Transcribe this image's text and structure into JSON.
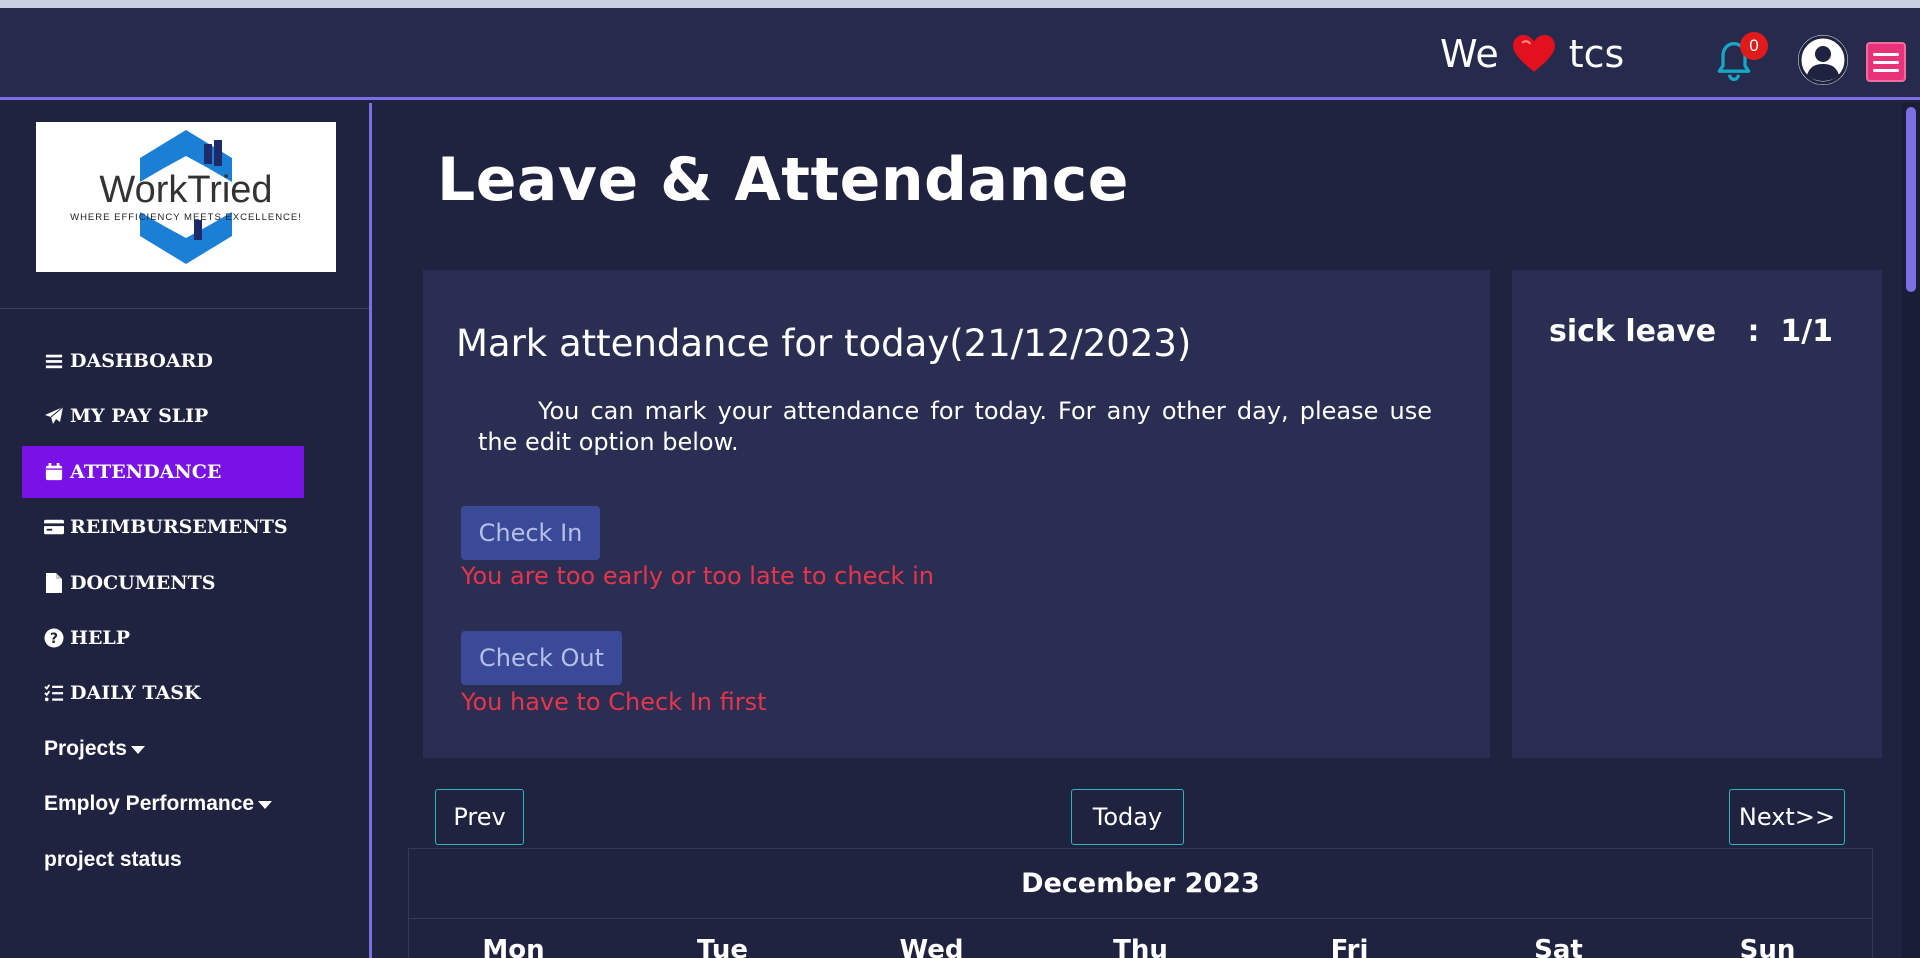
{
  "header": {
    "brand_we": "We",
    "brand_company": "tcs",
    "notification_count": "0",
    "accent_color": "#7c6fe3",
    "menu_color": "#e8327a"
  },
  "sidebar": {
    "logo": {
      "name": "WorkTried",
      "tagline": "WHERE EFFICIENCY MEETS EXCELLENCE!"
    },
    "items": [
      {
        "label": "DASHBOARD",
        "icon": "bars-icon"
      },
      {
        "label": "MY PAY SLIP",
        "icon": "paper-plane-icon"
      },
      {
        "label": "ATTENDANCE",
        "icon": "calendar-icon",
        "active": true
      },
      {
        "label": "REIMBURSEMENTS",
        "icon": "credit-card-icon"
      },
      {
        "label": "DOCUMENTS",
        "icon": "file-icon"
      },
      {
        "label": "HELP",
        "icon": "question-circle-icon"
      },
      {
        "label": "DAILY TASK",
        "icon": "task-list-icon"
      },
      {
        "label": "Projects",
        "icon": "caret-down-icon"
      },
      {
        "label": "Employ Performance",
        "icon": "caret-down-icon"
      },
      {
        "label": "project status"
      }
    ],
    "active_color": "#7a12e8"
  },
  "main": {
    "page_title": "Leave & Attendance",
    "attendance": {
      "title": "Mark attendance for today(21/12/2023)",
      "description": "You can mark your attendance for today. For any other day, please use the edit option below.",
      "check_in_label": "Check In",
      "check_in_error": "You are too early or too late to check in",
      "check_out_label": "Check Out",
      "check_out_error": "You have to Check In first",
      "error_color": "#e8344a"
    },
    "leave": {
      "label": "sick leave",
      "separator": ":",
      "value": "1/1"
    },
    "calendar": {
      "prev_label": "Prev",
      "today_label": "Today",
      "next_label": "Next>>",
      "month": "December 2023",
      "weekdays": [
        "Mon",
        "Tue",
        "Wed",
        "Thu",
        "Fri",
        "Sat",
        "Sun"
      ]
    }
  }
}
